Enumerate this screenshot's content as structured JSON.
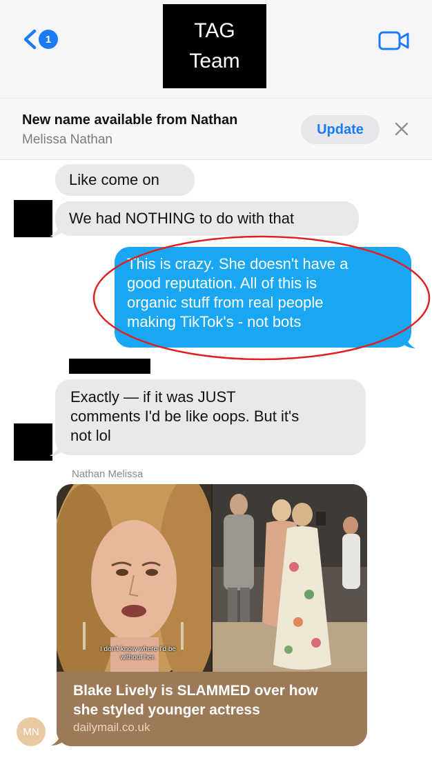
{
  "header": {
    "back_badge": "1",
    "title_line1": "TAG",
    "title_line2": "Team"
  },
  "banner": {
    "title": "New name available from Nathan",
    "subtitle": "Melissa Nathan",
    "update_label": "Update"
  },
  "messages": [
    {
      "direction": "received",
      "text": "Like come on"
    },
    {
      "direction": "received",
      "text": "We had NOTHING to do with that"
    },
    {
      "direction": "sent",
      "lines": [
        "This is crazy. She doesn't have a",
        "good reputation. All of this is",
        "organic stuff from real people",
        "making TikTok's - not bots"
      ]
    },
    {
      "direction": "received",
      "lines": [
        "Exactly — if it was JUST",
        "comments I'd be like oops. But it's",
        "not lol"
      ]
    }
  ],
  "link_message": {
    "sender": "Nathan Melissa",
    "image_caption_line1": "I don't know where I'd be",
    "image_caption_line2": "without her.",
    "title_line1": "Blake Lively is SLAMMED over how",
    "title_line2": "she styled younger actress",
    "domain": "dailymail.co.uk"
  },
  "avatar": {
    "initials": "MN"
  },
  "colors": {
    "ios_blue": "#1a7cf5",
    "sent_bubble": "#19a7f3",
    "received_bubble": "#e9e9eb",
    "highlight_oval": "#e02020"
  },
  "icons": [
    "chevron-left-icon",
    "video-camera-icon",
    "close-icon"
  ]
}
